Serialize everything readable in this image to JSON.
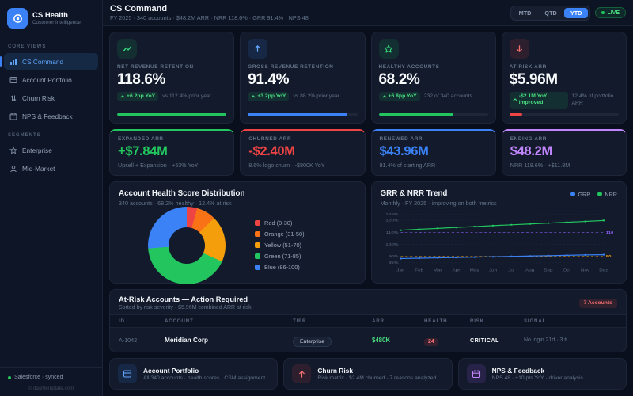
{
  "app": {
    "name": "CS Health",
    "tagline": "Customer Intelligence"
  },
  "sidebar": {
    "sections": [
      {
        "label": "CORE VIEWS",
        "items": [
          {
            "label": "CS Command",
            "active": true
          },
          {
            "label": "Account Portfolio",
            "active": false
          },
          {
            "label": "Churn Risk",
            "active": false
          },
          {
            "label": "NPS & Feedback",
            "active": false
          }
        ]
      },
      {
        "label": "SEGMENTS",
        "items": [
          {
            "label": "Enterprise",
            "active": false
          },
          {
            "label": "Mid-Market",
            "active": false
          }
        ]
      }
    ],
    "footer": {
      "sync_label": "Salesforce · synced",
      "watermark": "© dashtemplate.com"
    }
  },
  "header": {
    "title": "CS Command",
    "subtitle": "FY 2025 · 340 accounts · $48.2M ARR · NRR 118.6% · GRR 91.4% · NPS 48",
    "ranges": {
      "mtd": "MTD",
      "qtd": "QTD",
      "ytd": "YTD",
      "active": "YTD"
    },
    "live_label": "LIVE"
  },
  "kpis": [
    {
      "label": "NET REVENUE RETENTION",
      "value": "118.6%",
      "badge": "+6.2pp YoY",
      "caption": "vs 112.4% prior year",
      "accent": "#22c55e",
      "progress": "100%"
    },
    {
      "label": "GROSS REVENUE RETENTION",
      "value": "91.4%",
      "badge": "+3.2pp YoY",
      "caption": "vs 88.2% prior year",
      "accent": "#3b82f6",
      "progress": "91%"
    },
    {
      "label": "HEALTHY ACCOUNTS",
      "value": "68.2%",
      "badge": "+6.8pp YoY",
      "caption": "232 of 340 accounts",
      "accent": "#22c55e",
      "progress": "68%"
    },
    {
      "label": "AT-RISK ARR",
      "value": "$5.96M",
      "badge": "-$2.1M YoY improved",
      "caption": "12.4% of portfolio ARR",
      "accent": "#ef4444",
      "progress": "12%"
    }
  ],
  "arr_cards": [
    {
      "label": "EXPANDED ARR",
      "value": "+$7.84M",
      "caption": "Upsell + Expansion · +53% YoY",
      "color": "#22c55e"
    },
    {
      "label": "CHURNED ARR",
      "value": "-$2.40M",
      "caption": "8.6% logo churn · -$800K YoY",
      "color": "#ef4444"
    },
    {
      "label": "RENEWED ARR",
      "value": "$43.96M",
      "caption": "91.4% of starting ARR",
      "color": "#3b82f6"
    },
    {
      "label": "ENDING ARR",
      "value": "$48.2M",
      "caption": "NRR 118.6% · +$11.8M",
      "color": "#c084fc"
    }
  ],
  "health_card": {
    "title": "Account Health Score Distribution",
    "subtitle": "340 accounts · 68.2% healthy · 12.4% at risk"
  },
  "trend_card": {
    "title": "GRR & NRR Trend",
    "subtitle": "Monthly · FY 2025 · improving on both metrics"
  },
  "chart_data": [
    {
      "type": "pie",
      "title": "Account Health Score Distribution",
      "slices": [
        {
          "label": "Red (0-30)",
          "value": 4.4,
          "color": "#ef4444"
        },
        {
          "label": "Orange (31-50)",
          "value": 8.0,
          "color": "#f97316"
        },
        {
          "label": "Yellow (51-70)",
          "value": 19.4,
          "color": "#f59e0b"
        },
        {
          "label": "Green (71-85)",
          "value": 42.0,
          "color": "#22c55e"
        },
        {
          "label": "Blue (86-100)",
          "value": 26.2,
          "color": "#3b82f6"
        }
      ]
    },
    {
      "type": "line",
      "title": "GRR & NRR Trend",
      "x": [
        "Jan",
        "Feb",
        "Mar",
        "Apr",
        "May",
        "Jun",
        "Jul",
        "Aug",
        "Sep",
        "Oct",
        "Nov",
        "Dec"
      ],
      "series": [
        {
          "name": "GRR",
          "color": "#3b82f6",
          "values": [
            88.2,
            88.5,
            88.8,
            89.1,
            89.4,
            89.7,
            90.0,
            90.3,
            90.6,
            90.9,
            91.2,
            91.4
          ]
        },
        {
          "name": "NRR",
          "color": "#22c55e",
          "values": [
            111.8,
            112.6,
            113.3,
            114.1,
            114.8,
            115.6,
            116.3,
            117.0,
            117.7,
            118.4,
            119.1,
            119.9
          ]
        }
      ],
      "yticks": [
        125,
        120,
        110,
        100,
        90,
        85
      ],
      "ylim": [
        83,
        127
      ],
      "targets": [
        {
          "value": 110,
          "label": "110",
          "color": "#8b5cf6"
        },
        {
          "value": 90,
          "label": "90",
          "color": "#f59e0b"
        }
      ],
      "legend_position": "top-right",
      "grid": true
    }
  ],
  "risk_table": {
    "title": "At-Risk Accounts — Action Required",
    "subtitle": "Sorted by risk severity · $5.96M combined ARR at risk",
    "badge": "7 Accounts",
    "columns": [
      "ID",
      "ACCOUNT",
      "TIER",
      "ARR",
      "HEALTH",
      "RISK",
      "SIGNAL"
    ],
    "rows": [
      {
        "id": "A-1042",
        "account": "Meridian Corp",
        "tier": "Enterprise",
        "arr": "$480K",
        "health": "24",
        "risk": "CRITICAL",
        "signal": "No login 21d · 3 ti…"
      }
    ]
  },
  "footer_cards": [
    {
      "title": "Account Portfolio",
      "caption": "All 340 accounts · health scores · CSM assignment",
      "color": "#3b82f6"
    },
    {
      "title": "Churn Risk",
      "caption": "Risk matrix · $2.4M churned · 7 reasons analyzed",
      "color": "#ef4444"
    },
    {
      "title": "NPS & Feedback",
      "caption": "NPS 48 · +10 pts YoY · driver analysis",
      "color": "#a855f7"
    }
  ]
}
